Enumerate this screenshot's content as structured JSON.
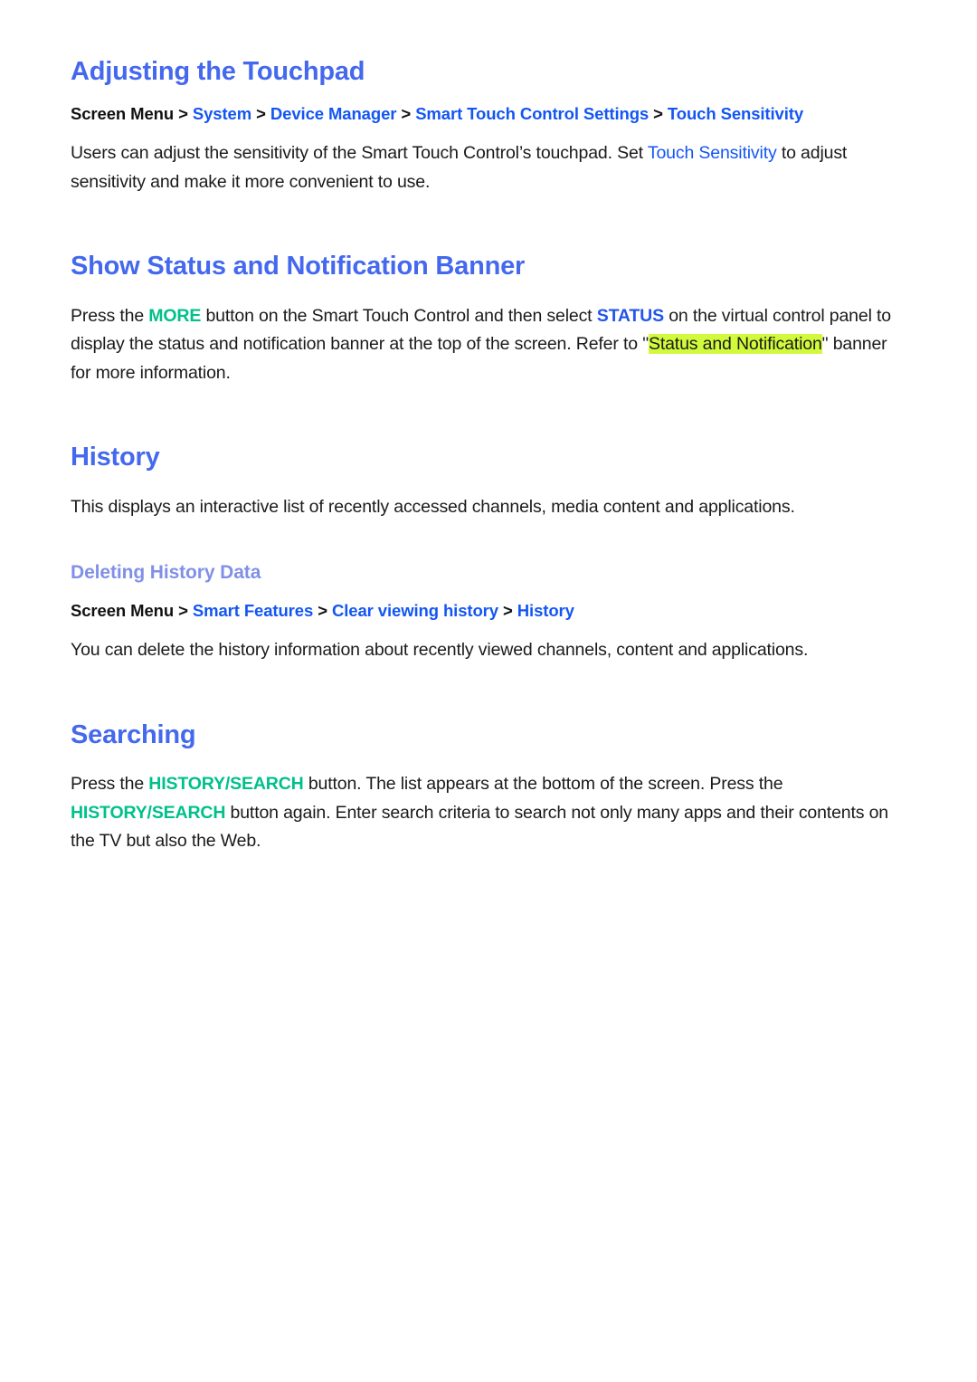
{
  "document": {
    "title": "Smart Touch Control / History / Searching help page"
  },
  "sections": [
    {
      "id": "adjusting-the-touchpad",
      "heading": "Adjusting the Touchpad",
      "breadcrumb": {
        "root": "Screen Menu",
        "separator": ">",
        "items": [
          "System",
          "Device Manager",
          "Smart Touch Control Settings",
          "Touch Sensitivity"
        ]
      },
      "body": {
        "part1": "Users can adjust the sensitivity of the Smart Touch Control’s touchpad. Set ",
        "link1": "Touch Sensitivity",
        "part2": " to adjust sensitivity and make it more convenient to use."
      }
    },
    {
      "id": "show-status-and-notification-banner",
      "heading": "Show Status and Notification Banner",
      "body": {
        "part1": "Press the ",
        "key1": "MORE",
        "part2": " button on the Smart Touch Control and then select ",
        "key2": "STATUS",
        "part3": " on the virtual control panel to display the status and notification banner at the top of the screen. Refer to \"",
        "highlight": "Status and Notification",
        "part4": "\" banner for more information."
      }
    },
    {
      "id": "history",
      "heading": "History",
      "body": "This displays an interactive list of recently accessed channels, media content and applications.",
      "subsection": {
        "id": "deleting-history-data",
        "heading": "Deleting History Data",
        "breadcrumb": {
          "root": "Screen Menu",
          "separator": ">",
          "items": [
            "Smart Features",
            "Clear viewing history",
            "History"
          ]
        },
        "body": "You can delete the history information about recently viewed channels, content and applications."
      }
    },
    {
      "id": "searching",
      "heading": "Searching",
      "body": {
        "part1": "Press the ",
        "key1": "HISTORY/SEARCH",
        "part2": " button. The list appears at the bottom of the screen. Press the ",
        "key2": "HISTORY/SEARCH",
        "part3": " button again. Enter search criteria to search not only many apps and their contents on the TV but also the Web."
      }
    }
  ],
  "colors": {
    "heading_blue": "#4468ee",
    "subheading_blue": "#8090e8",
    "link_blue": "#1356f3",
    "key_blue": "#2255ee",
    "key_teal": "#00c08b",
    "highlight_yellow_green": "#d2fa3c",
    "body_text": "#1a1a1a",
    "page_background": "#ffffff"
  }
}
